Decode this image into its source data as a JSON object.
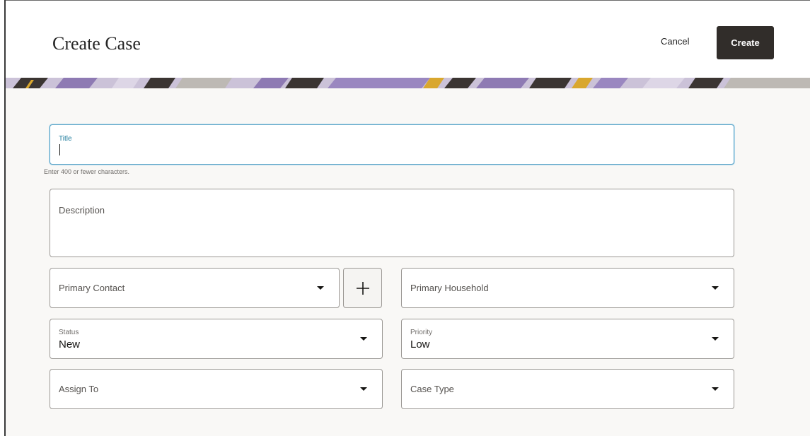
{
  "header": {
    "title": "Create Case",
    "cancel_label": "Cancel",
    "create_label": "Create"
  },
  "form": {
    "title_field": {
      "label": "Title",
      "value": "",
      "helper": "Enter 400 or fewer characters."
    },
    "description_field": {
      "label": "Description",
      "value": ""
    },
    "primary_contact": {
      "label": "Primary Contact",
      "value": ""
    },
    "add_contact_icon": "plus-icon",
    "primary_household": {
      "label": "Primary Household",
      "value": ""
    },
    "status": {
      "label": "Status",
      "value": "New"
    },
    "priority": {
      "label": "Priority",
      "value": "Low"
    },
    "assign_to": {
      "label": "Assign To",
      "value": ""
    },
    "case_type": {
      "label": "Case Type",
      "value": ""
    }
  },
  "colors": {
    "primary_button": "#312d2a",
    "focus_border": "#5fa6c8",
    "focus_label": "#227e9e",
    "banner_lilac": "#cbc2d8",
    "banner_purple": "#8e7ab3",
    "banner_dark": "#3b3532",
    "banner_gold": "#d9a72e"
  }
}
